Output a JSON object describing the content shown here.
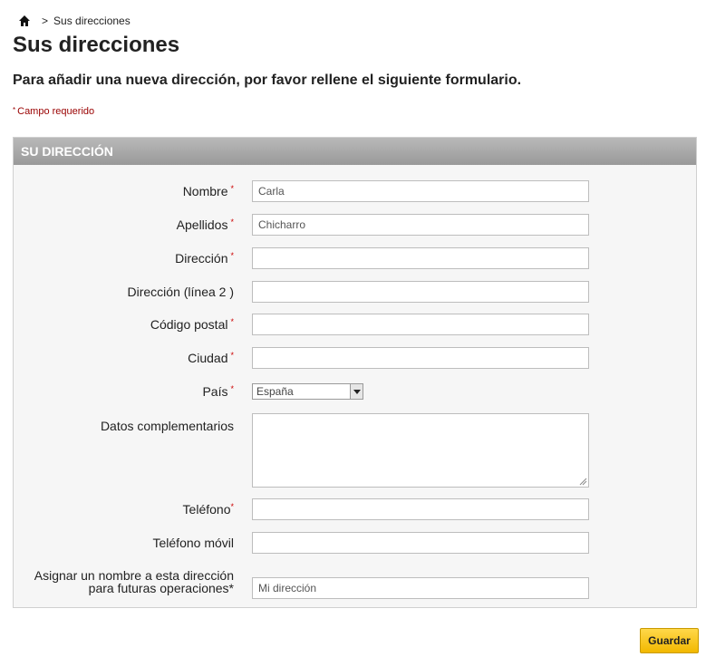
{
  "breadcrumb": {
    "home_icon": "home-icon",
    "separator": ">",
    "current": "Sus direcciones"
  },
  "page_title": "Sus direcciones",
  "intro": "Para añadir una nueva dirección, por favor rellene el siguiente formulario.",
  "required_note": {
    "star": "*",
    "text": "Campo requerido"
  },
  "form": {
    "section_title": "Su dirección",
    "required_star": "*",
    "fields": {
      "nombre": {
        "label": "Nombre",
        "value": "Carla"
      },
      "apellidos": {
        "label": "Apellidos",
        "value": "Chicharro"
      },
      "direccion": {
        "label": "Dirección",
        "value": ""
      },
      "direccion2": {
        "label": "Dirección (línea 2 )",
        "value": ""
      },
      "codigo_postal": {
        "label": "Código postal",
        "value": ""
      },
      "ciudad": {
        "label": "Ciudad",
        "value": ""
      },
      "pais": {
        "label": "País",
        "value": "España"
      },
      "datos": {
        "label": "Datos complementarios",
        "value": ""
      },
      "telefono": {
        "label": "Teléfono",
        "value": ""
      },
      "movil": {
        "label": "Teléfono móvil",
        "value": ""
      },
      "alias": {
        "label_line1": "Asignar un nombre a esta dirección",
        "label_line2": "para futuras operaciones",
        "value": "Mi dirección"
      }
    }
  },
  "save_label": "Guardar",
  "colors": {
    "accent_button": "#f2b800",
    "required": "#cc0000",
    "header_bar": "#a9a9a9"
  }
}
